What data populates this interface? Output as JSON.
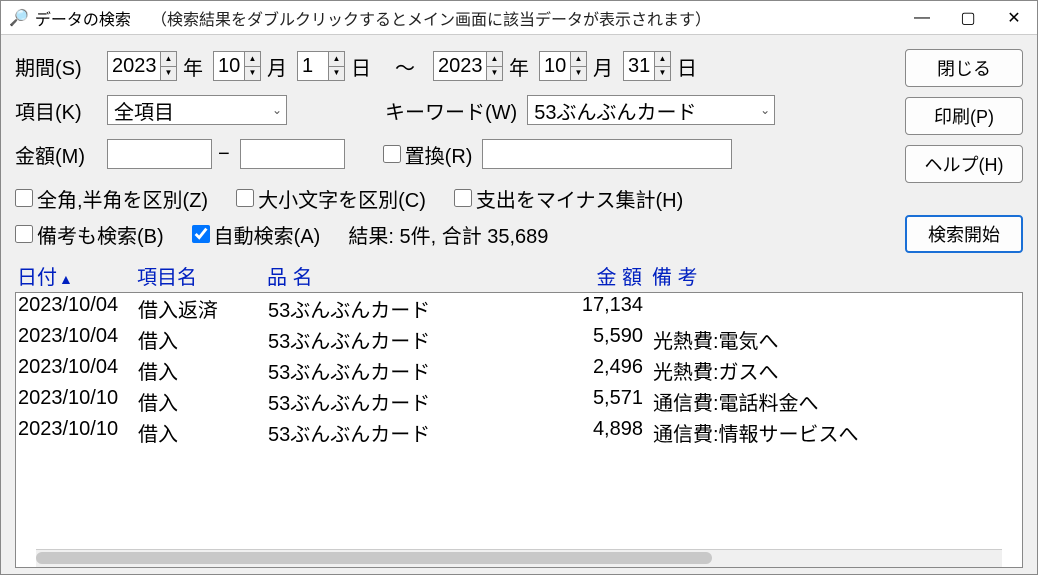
{
  "window": {
    "title": "データの検索",
    "hint": "（検索結果をダブルクリックするとメイン画面に該当データが表示されます）"
  },
  "buttons": {
    "close": "閉じる",
    "print": "印刷(P)",
    "help": "ヘルプ(H)",
    "search": "検索開始"
  },
  "period": {
    "label": "期間(S)",
    "from_year": "2023",
    "from_month": "10",
    "from_day": "1",
    "to_year": "2023",
    "to_month": "10",
    "to_day": "31",
    "unit_year": "年",
    "unit_month": "月",
    "unit_day": "日",
    "tilde": "～"
  },
  "item": {
    "label": "項目(K)",
    "value": "全項目"
  },
  "keyword": {
    "label": "キーワード(W)",
    "value": "53ぶんぶんカード"
  },
  "amount": {
    "label": "金額(M)",
    "from": "",
    "to": "",
    "dash": "−"
  },
  "replace": {
    "label": "置換(R)",
    "value": ""
  },
  "options": {
    "zenkaku": "全角,半角を区別(Z)",
    "casesens": "大小文字を区別(C)",
    "expminus": "支出をマイナス集計(H)",
    "memo": "備考も検索(B)",
    "auto": "自動検索(A)"
  },
  "options_state": {
    "zenkaku": false,
    "casesens": false,
    "expminus": false,
    "memo": false,
    "auto": true
  },
  "result": {
    "text": "結果:  5件, 合計 35,689"
  },
  "columns": {
    "date": "日付",
    "item": "項目名",
    "name": "品 名",
    "amount": "金 額",
    "memo": "備 考"
  },
  "rows": [
    {
      "date": "2023/10/04",
      "item": "借入返済",
      "name": "53ぶんぶんカード",
      "amount": "17,134",
      "memo": ""
    },
    {
      "date": "2023/10/04",
      "item": "借入",
      "name": "53ぶんぶんカード",
      "amount": "5,590",
      "memo": "光熱費:電気へ"
    },
    {
      "date": "2023/10/04",
      "item": "借入",
      "name": "53ぶんぶんカード",
      "amount": "2,496",
      "memo": "光熱費:ガスへ"
    },
    {
      "date": "2023/10/10",
      "item": "借入",
      "name": "53ぶんぶんカード",
      "amount": "5,571",
      "memo": "通信費:電話料金へ"
    },
    {
      "date": "2023/10/10",
      "item": "借入",
      "name": "53ぶんぶんカード",
      "amount": "4,898",
      "memo": "通信費:情報サービスへ"
    }
  ]
}
